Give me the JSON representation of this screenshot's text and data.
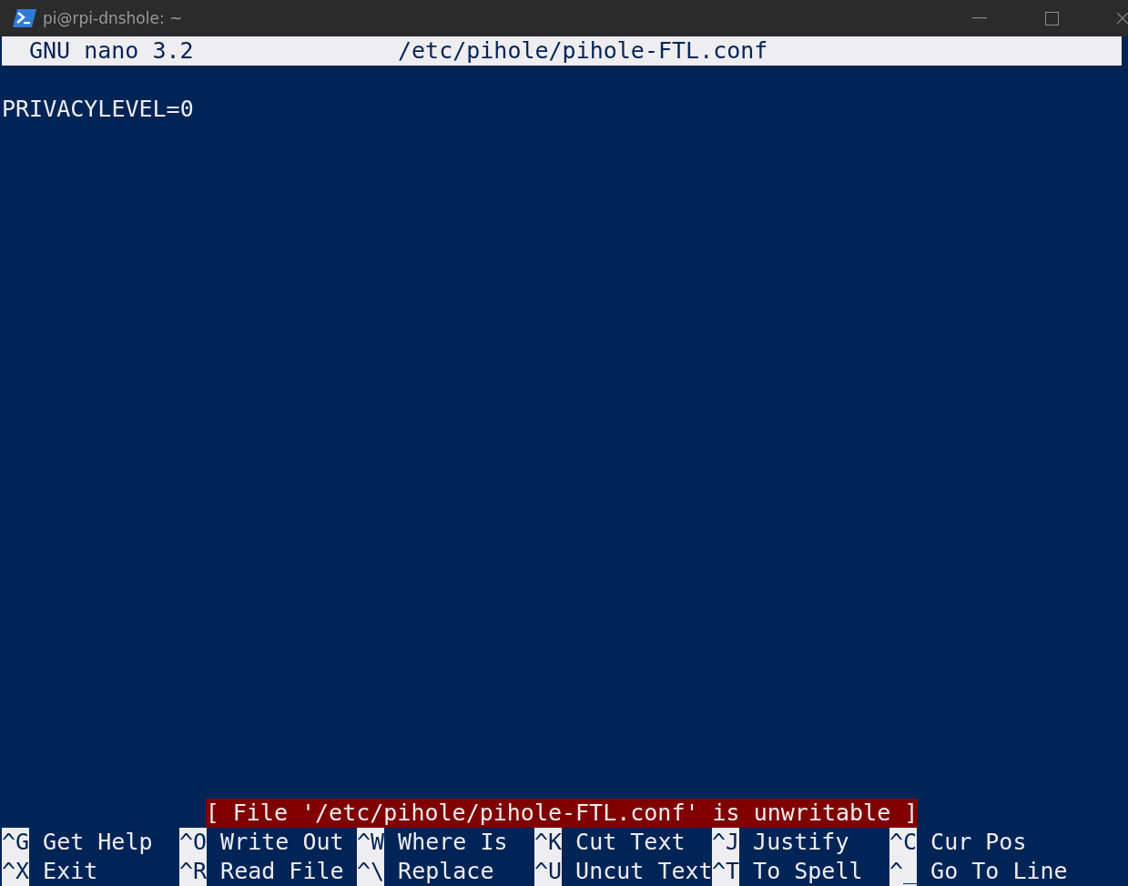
{
  "window": {
    "title": "pi@rpi-dnshole: ~"
  },
  "editor": {
    "version": "GNU nano 3.2",
    "filename": "/etc/pihole/pihole-FTL.conf",
    "lines": [
      "PRIVACYLEVEL=0"
    ],
    "status_message": "[ File '/etc/pihole/pihole-FTL.conf' is unwritable ]"
  },
  "shortcut_rows": [
    {
      "items": [
        {
          "key": "^G",
          "label": "Get Help"
        },
        {
          "key": "^O",
          "label": "Write Out"
        },
        {
          "key": "^W",
          "label": "Where Is"
        },
        {
          "key": "^K",
          "label": "Cut Text"
        },
        {
          "key": "^J",
          "label": "Justify"
        },
        {
          "key": "^C",
          "label": "Cur Pos"
        }
      ]
    },
    {
      "items": [
        {
          "key": "^X",
          "label": "Exit"
        },
        {
          "key": "^R",
          "label": "Read File"
        },
        {
          "key": "^\\",
          "label": "Replace"
        },
        {
          "key": "^U",
          "label": "Uncut Text"
        },
        {
          "key": "^T",
          "label": "To Spell"
        },
        {
          "key": "^_",
          "label": "Go To Line"
        }
      ]
    }
  ]
}
